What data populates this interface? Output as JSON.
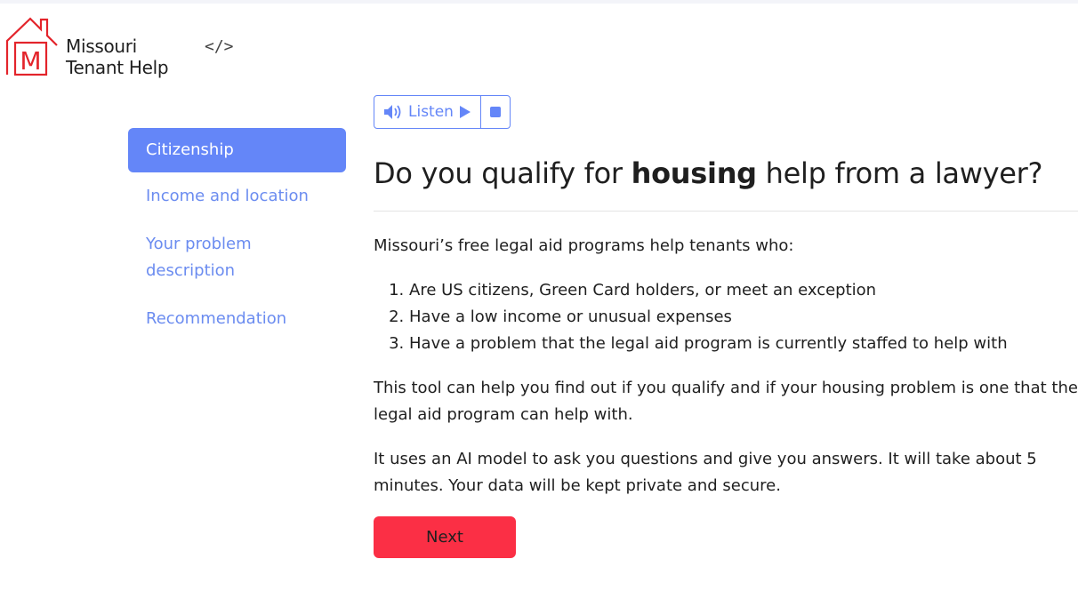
{
  "header": {
    "logo_letter": "M",
    "logo_line1": "Missouri",
    "logo_line2": "Tenant Help",
    "code_icon": "</>"
  },
  "colors": {
    "accent": "#6486f8",
    "next_button": "#fb2f45",
    "logo_red": "#e3242b"
  },
  "sidebar": {
    "items": [
      {
        "label": "Citizenship",
        "active": true
      },
      {
        "label": "Income and location",
        "active": false
      },
      {
        "label": "Your problem description",
        "active": false
      },
      {
        "label": "Recommendation",
        "active": false
      }
    ]
  },
  "audio": {
    "listen_label": "Listen",
    "speaker_icon": "speaker-icon",
    "play_icon": "play-icon",
    "stop_icon": "stop-icon"
  },
  "main": {
    "title_pre": "Do you qualify for ",
    "title_bold": "housing",
    "title_post": " help from a lawyer?",
    "intro": "Missouri’s free legal aid programs help tenants who:",
    "criteria": [
      "Are US citizens, Green Card holders, or meet an exception",
      "Have a low income or unusual expenses",
      "Have a problem that the legal aid program is currently staffed to help with"
    ],
    "paragraph2": "This tool can help you find out if you qualify and if your housing problem is one that the legal aid program can help with.",
    "paragraph3": "It uses an AI model to ask you questions and give you answers. It will take about 5 minutes. Your data will be kept private and secure.",
    "next_label": "Next"
  }
}
